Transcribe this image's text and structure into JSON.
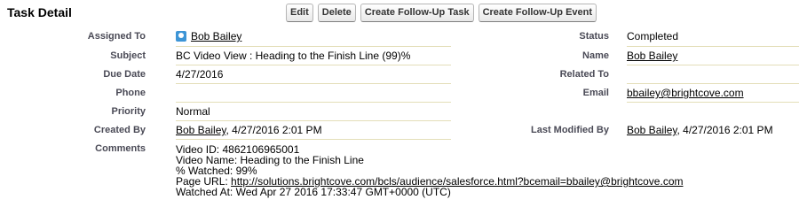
{
  "section_title": "Task Detail",
  "buttons": {
    "edit": "Edit",
    "delete": "Delete",
    "follow_task": "Create Follow-Up Task",
    "follow_event": "Create Follow-Up Event"
  },
  "fields": {
    "assigned_to": {
      "label": "Assigned To",
      "value": "Bob Bailey"
    },
    "status": {
      "label": "Status",
      "value": "Completed"
    },
    "subject": {
      "label": "Subject",
      "value": "BC Video View : Heading to the Finish Line (99)%"
    },
    "name": {
      "label": "Name",
      "value": "Bob Bailey"
    },
    "due_date": {
      "label": "Due Date",
      "value": "4/27/2016"
    },
    "related_to": {
      "label": "Related To",
      "value": ""
    },
    "phone": {
      "label": "Phone",
      "value": ""
    },
    "email": {
      "label": "Email",
      "value": "bbailey@brightcove.com"
    },
    "priority": {
      "label": "Priority",
      "value": "Normal"
    },
    "created_by": {
      "label": "Created By",
      "user": "Bob Bailey",
      "date": ", 4/27/2016 2:01 PM"
    },
    "last_modified_by": {
      "label": "Last Modified By",
      "user": "Bob Bailey",
      "date": ", 4/27/2016 2:01 PM"
    },
    "comments": {
      "label": "Comments",
      "lines": {
        "video_id": "Video ID: 4862106965001",
        "video_name": "Video Name: Heading to the Finish Line",
        "watched": "% Watched: 99%",
        "page_url_prefix": "Page URL: ",
        "page_url": "http://solutions.brightcove.com/bcls/audience/salesforce.html?bcemail=bbailey@brightcove.com",
        "watched_at": "Watched At: Wed Apr 27 2016 17:33:47 GMT+0000 (UTC)"
      }
    }
  },
  "colors": {
    "label": "#4a4a56",
    "divider": "#e3deb8",
    "avatar": "#3d95d6"
  },
  "icons": {
    "assigned_to": "user-avatar-icon"
  }
}
